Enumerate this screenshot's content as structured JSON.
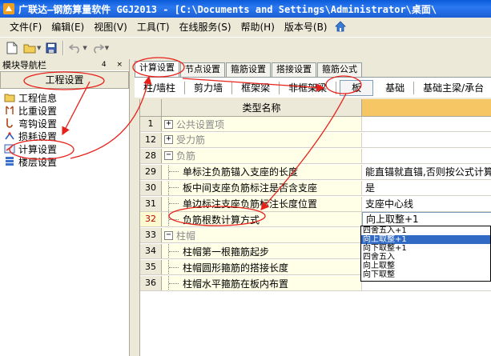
{
  "window": {
    "title": "广联达—钢筋算量软件 GGJ2013 - [C:\\Documents and Settings\\Administrator\\桌面\\"
  },
  "menu": [
    {
      "label": "文件(F)"
    },
    {
      "label": "编辑(E)"
    },
    {
      "label": "视图(V)"
    },
    {
      "label": "工具(T)"
    },
    {
      "label": "在线服务(S)"
    },
    {
      "label": "帮助(H)"
    },
    {
      "label": "版本号(B)"
    }
  ],
  "toolbar": {
    "icons": [
      "new-file-icon",
      "open-folder-icon",
      "save-icon",
      "undo-icon",
      "redo-icon"
    ]
  },
  "nav": {
    "title": "模块导航栏",
    "controls": "4 × ",
    "group_label": "工程设置",
    "items": [
      {
        "label": "工程信息",
        "icon": "project-info-icon"
      },
      {
        "label": "比重设置",
        "icon": "weight-icon"
      },
      {
        "label": "弯钩设置",
        "icon": "hook-icon"
      },
      {
        "label": "损耗设置",
        "icon": "loss-icon"
      },
      {
        "label": "计算设置",
        "icon": "calc-settings-icon"
      },
      {
        "label": "楼层设置",
        "icon": "floor-settings-icon"
      }
    ]
  },
  "tabs": [
    {
      "label": "计算设置",
      "active": true
    },
    {
      "label": "节点设置"
    },
    {
      "label": "箍筋设置"
    },
    {
      "label": "搭接设置"
    },
    {
      "label": "箍筋公式"
    }
  ],
  "subtabs": [
    {
      "label": "柱/墙柱"
    },
    {
      "label": "剪力墙"
    },
    {
      "label": "框架梁"
    },
    {
      "label": "非框架梁"
    },
    {
      "label": "板",
      "selected": true
    },
    {
      "label": "基础"
    },
    {
      "label": "基础主梁/承台"
    }
  ],
  "grid": {
    "column_header": "类型名称",
    "rows": [
      {
        "num": "1",
        "name": "公共设置项",
        "type": "group",
        "expander": "+",
        "value": ""
      },
      {
        "num": "12",
        "name": "受力筋",
        "type": "group",
        "expander": "+",
        "value": ""
      },
      {
        "num": "28",
        "name": "负筋",
        "type": "group",
        "expander": "−",
        "value": ""
      },
      {
        "num": "29",
        "name": "单标注负筋锚入支座的长度",
        "type": "child",
        "value": "能直锚就直锚,否则按公式计算"
      },
      {
        "num": "30",
        "name": "板中间支座负筋标注是否含支座",
        "type": "child",
        "value": "是"
      },
      {
        "num": "31",
        "name": "单边标注支座负筋标注长度位置",
        "type": "child",
        "value": "支座中心线"
      },
      {
        "num": "32",
        "name": "负筋根数计算方式",
        "type": "child",
        "current": true,
        "value": "向上取整+1"
      },
      {
        "num": "33",
        "name": "柱帽",
        "type": "group",
        "expander": "−",
        "value": ""
      },
      {
        "num": "34",
        "name": "柱帽第一根箍筋起步",
        "type": "child",
        "value": ""
      },
      {
        "num": "35",
        "name": "柱帽圆形箍筋的搭接长度",
        "type": "child",
        "value": ""
      },
      {
        "num": "36",
        "name": "柱帽水平箍筋在板内布置",
        "type": "child",
        "value": ""
      }
    ]
  },
  "dropdown": {
    "options": [
      {
        "label": "四舍五入+1"
      },
      {
        "label": "向上取整+1",
        "highlighted": true
      },
      {
        "label": "向下取整+1"
      },
      {
        "label": "四舍五入"
      },
      {
        "label": "向上取整"
      },
      {
        "label": "向下取整"
      }
    ]
  },
  "colors": {
    "annotation": "#e8201a",
    "title_bar": "#1c5fd6",
    "column_highlight": "#f6c664",
    "selection": "#316ac5"
  }
}
